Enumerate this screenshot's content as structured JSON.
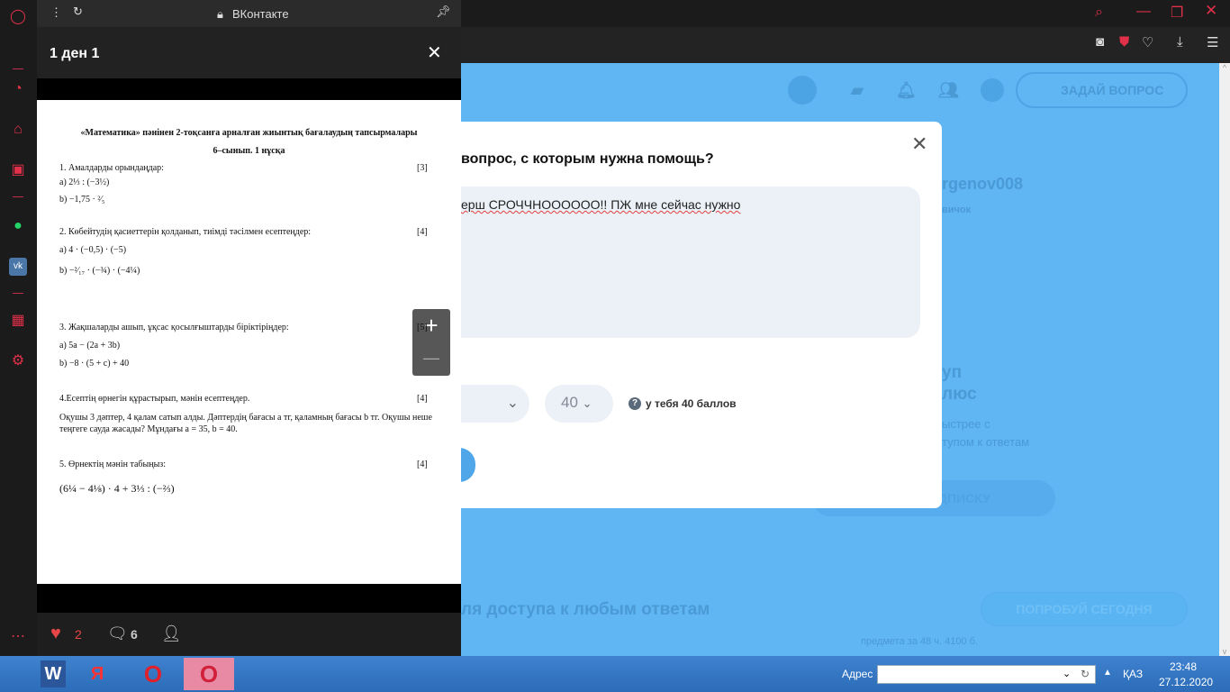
{
  "browser": {
    "addr_label": "ВКонтакте"
  },
  "vk": {
    "title": "1 ден 1",
    "likes": "2",
    "comments": "6"
  },
  "document": {
    "title": "«Математика» пәнінен 2-тоқсанға арналған жиынтық бағалаудың тапсырмалары",
    "subtitle": "6–сынып. 1 нұсқа",
    "tasks": [
      {
        "head": "1. Амалдарды орындаңдар:",
        "points": "[3]",
        "items": [
          "a) 2⅓ : (−3½)",
          "b) −1,75 · ²⁄₅"
        ]
      },
      {
        "head": "2. Көбейтудің қасиеттерін қолданып, тиімді тәсілмен есептеңдер:",
        "points": "[4]",
        "items": [
          "a) 4 · (−0,5) · (−5)",
          "b) −²⁄₁₇ · (−¾) · (−4¼)"
        ]
      },
      {
        "head": "3. Жақшаларды ашып, ұқсас қосылғыштарды біріктіріңдер:",
        "points": "[5]",
        "items": [
          "a) 5a − (2a + 3b)",
          "b) −8 · (5 + c) + 40"
        ]
      },
      {
        "head": "4.Есептің өрнегін құрастырып, мәнін есептеңдер.",
        "points": "[4]",
        "items": [
          "Оқушы 3 дәптер, 4  қалам сатып алды. Дәптердің бағасы a тг, қаламның бағасы b тг. Оқушы неше",
          "теңгеге сауда жасады? Мұндағы a = 35, b = 40."
        ]
      },
      {
        "head": "5. Өрнектің мәнін табыңыз:",
        "points": "[4]",
        "items": [
          "(6¼ − 4⅛) · 4 + 3⅓ : (−⅔)"
        ]
      }
    ]
  },
  "modal": {
    "heading": "вопрос, с которым нужна помощь?",
    "text": "ерш СРОЧЧНОООООО!! ПЖ мне сейчас нужно",
    "points_value": "40",
    "balance": "у тебя 40 баллов"
  },
  "site": {
    "ask_button": "ЗАДАЙ ВОПРОС",
    "username": "rgenov008",
    "rank": "вичок",
    "promo1": "уп",
    "promo2": "люс",
    "promo3": "ыстрее с",
    "promo4": "тупом к ответам",
    "sub_btn": "ДПИСКУ",
    "banner": "ля доступа к любым ответам",
    "try_btn": "ПОПРОБУЙ СЕГОДНЯ",
    "footer": "предмета за 48 ч. 4100 б."
  },
  "taskbar": {
    "address_label": "Адрес",
    "lang": "ҚАЗ",
    "time": "23:48",
    "date": "27.12.2020",
    "apps": [
      "W",
      "Я",
      "O",
      "O"
    ]
  },
  "colors": {
    "opera_red": "#e0304a",
    "overlay_blue": "#5fb6f2",
    "like_red": "#e64646"
  }
}
